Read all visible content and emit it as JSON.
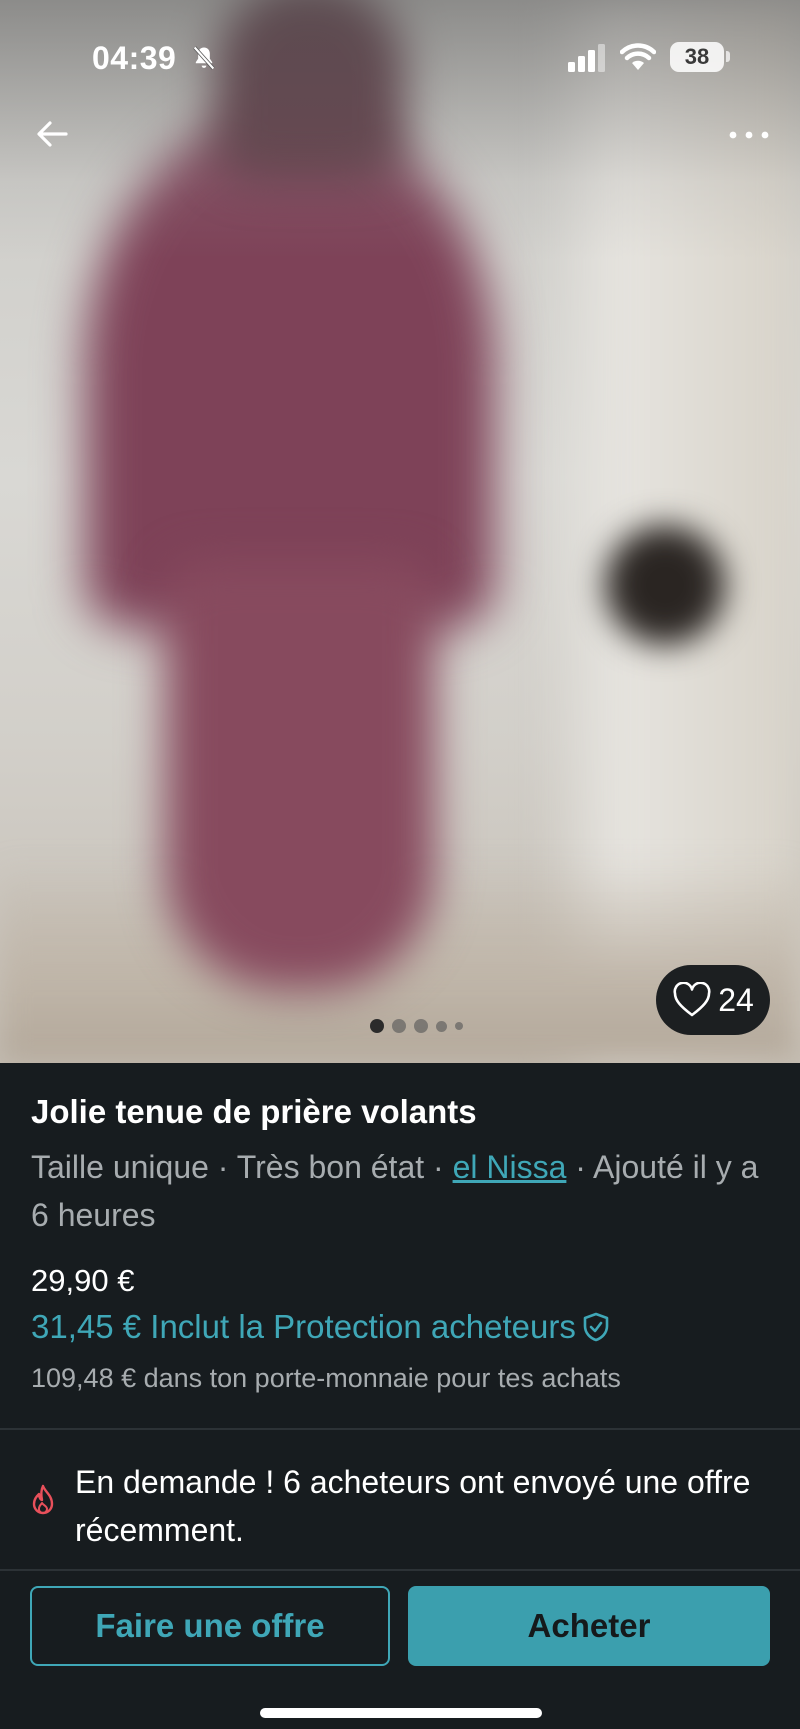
{
  "status_bar": {
    "time": "04:39",
    "battery_level": "38",
    "icons": [
      "bell-off-icon",
      "signal-icon",
      "wifi-icon",
      "battery-icon"
    ]
  },
  "navigation": {
    "back_icon": "arrow-left-icon",
    "more_icon": "more-dots-icon"
  },
  "gallery": {
    "photo_count": 5,
    "active_index": 0,
    "favorites_count": "24",
    "favorite_icon": "heart-outline-icon"
  },
  "item": {
    "title": "Jolie tenue de prière volants",
    "size": "Taille unique",
    "separator": " · ",
    "condition": "Très bon état",
    "seller": "el Nissa",
    "added": "Ajouté il y a 6 heures",
    "price": "29,90 €",
    "price_with_protection": "31,45 € Inclut la Protection acheteurs",
    "protection_icon": "shield-check-icon",
    "wallet_note": "109,48 € dans ton porte-monnaie pour tes achats"
  },
  "demand": {
    "icon": "flame-icon",
    "text": "En demande ! 6 acheteurs ont envoyé une offre récemment."
  },
  "actions": {
    "offer_label": "Faire une offre",
    "buy_label": "Acheter"
  },
  "colors": {
    "accent": "#3fa7b7",
    "background": "#171c1f",
    "demand_icon": "#e8505b"
  }
}
